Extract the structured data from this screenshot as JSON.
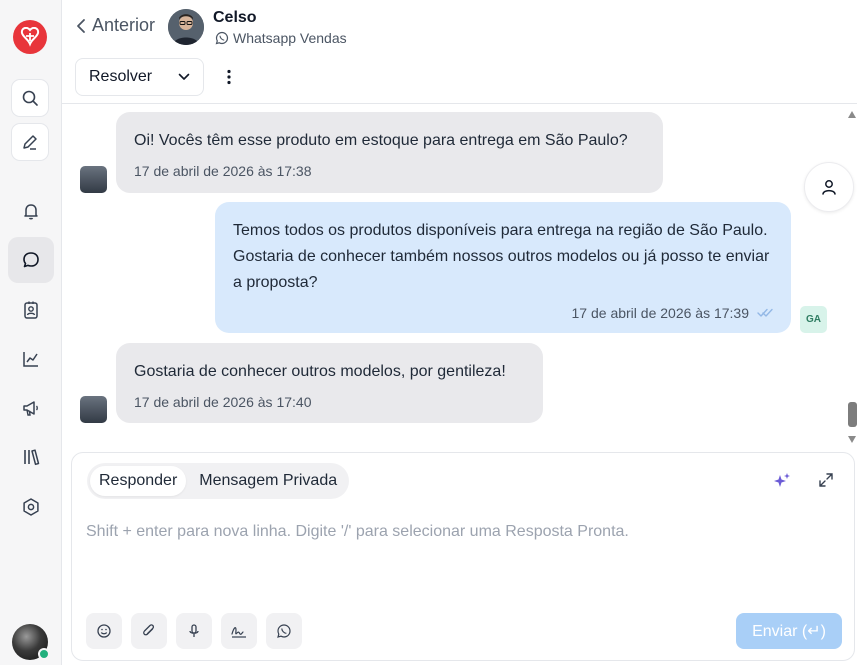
{
  "sidebar": {
    "logo": "app-logo",
    "search_icon": "search-icon",
    "compose_icon": "pencil-icon",
    "nav": [
      {
        "name": "notifications",
        "icon": "bell-icon"
      },
      {
        "name": "conversations",
        "icon": "chat-bubble-icon",
        "active": true
      },
      {
        "name": "contacts",
        "icon": "contact-card-icon"
      },
      {
        "name": "reports",
        "icon": "chart-line-icon"
      },
      {
        "name": "campaigns",
        "icon": "megaphone-icon"
      },
      {
        "name": "library",
        "icon": "books-icon"
      },
      {
        "name": "settings",
        "icon": "settings-icon"
      }
    ]
  },
  "header": {
    "back_label": "Anterior",
    "contact_name": "Celso",
    "channel": "Whatsapp Vendas",
    "resolve_label": "Resolver"
  },
  "messages": [
    {
      "direction": "in",
      "text": "Oi! Vocês têm esse produto em estoque para entrega em São Paulo?",
      "time": "17 de abril de 2026 às 17:38"
    },
    {
      "direction": "out",
      "text": "Temos todos os produtos disponíveis para entrega na região de São Paulo. Gostaria de conhecer também nossos outros modelos ou já posso te enviar a proposta?",
      "time": "17 de abril de 2026 às 17:39",
      "agent_initials": "GA"
    },
    {
      "direction": "in",
      "text": "Gostaria de conhecer outros modelos, por gentileza!",
      "time": "17 de abril de 2026 às 17:40"
    }
  ],
  "composer": {
    "tab_reply": "Responder",
    "tab_private": "Mensagem Privada",
    "placeholder": "Shift + enter para nova linha. Digite '/' para selecionar uma Resposta Pronta.",
    "send_label": "Enviar (↵)"
  },
  "colors": {
    "brand": "#e8353b",
    "incoming_bubble": "#e9e9ec",
    "outgoing_bubble": "#d8e9fc",
    "send_button": "#a9cff7",
    "online": "#22b07d"
  }
}
